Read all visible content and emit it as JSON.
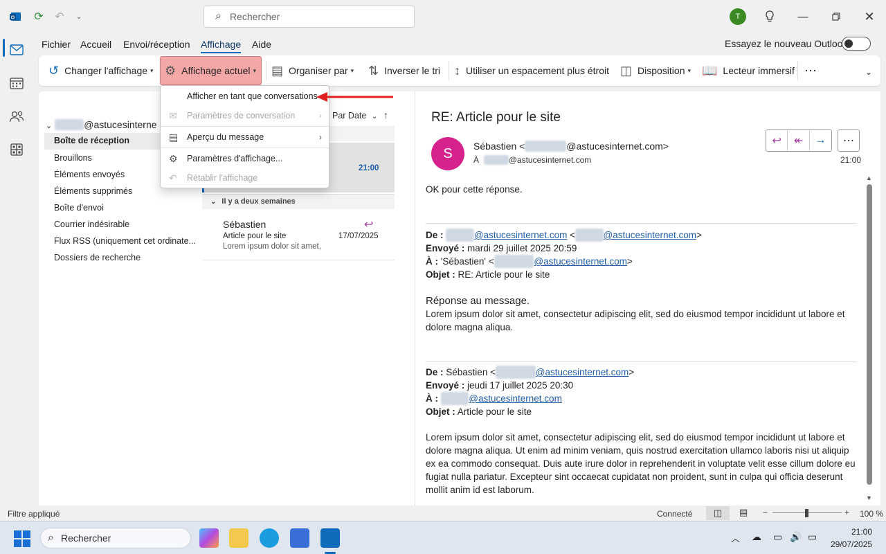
{
  "titlebar": {
    "search_placeholder": "Rechercher",
    "avatar_initial": "T"
  },
  "menu": {
    "tabs": [
      "Fichier",
      "Accueil",
      "Envoi/réception",
      "Affichage",
      "Aide"
    ],
    "active_tab": "Affichage",
    "new_outlook_label": "Essayez le nouveau Outlook"
  },
  "ribbon": {
    "change_view": "Changer l'affichage",
    "current_view": "Affichage actuel",
    "arrange_by": "Organiser par",
    "reverse_sort": "Inverser le tri",
    "compact_spacing": "Utiliser un espacement plus étroit",
    "layout": "Disposition",
    "immersive_reader": "Lecteur immersif"
  },
  "dropdown": {
    "items": [
      {
        "label": "Afficher en tant que conversations",
        "disabled": false
      },
      {
        "label": "Paramètres de conversation",
        "disabled": true
      },
      {
        "label": "Aperçu du message",
        "disabled": false
      },
      {
        "label": "Paramètres d'affichage...",
        "disabled": false
      },
      {
        "label": "Rétablir l'affichage",
        "disabled": true
      }
    ]
  },
  "folders": {
    "account_suffix": "@astucesinterne",
    "items": [
      "Boîte de réception",
      "Brouillons",
      "Éléments envoyés",
      "Éléments supprimés",
      "Boîte d'envoi",
      "Courrier indésirable",
      "Flux RSS (uniquement cet ordinate...",
      "Dossiers de recherche"
    ]
  },
  "message_list": {
    "sort_label": "Par Date",
    "selected_time": "21:00",
    "group_header": "Il y a deux semaines",
    "item": {
      "sender": "Sébastien",
      "subject": "Article pour le site",
      "preview": "Lorem ipsum dolor sit amet,",
      "date": "17/07/2025"
    }
  },
  "reading": {
    "subject": "RE: Article pour le site",
    "avatar_initial": "S",
    "from_name": "Sébastien <",
    "from_domain": "@astucesinternet.com>",
    "to_prefix": "À",
    "to_domain": "@astucesinternet.com",
    "time": "21:00",
    "body_first": "OK pour cette réponse.",
    "q1": {
      "de_label": "De :",
      "de_domain1": "@astucesinternet.com",
      "de_domain2": "@astucesinternet.com",
      "envoye_label": "Envoyé :",
      "envoye_value": "mardi 29 juillet 2025 20:59",
      "a_label": "À :",
      "a_value_prefix": "'Sébastien' <",
      "a_domain": "@astucesinternet.com",
      "objet_label": "Objet :",
      "objet_value": "RE: Article pour le site",
      "reply_title": "Réponse au message.",
      "reply_body": "Lorem ipsum dolor sit amet, consectetur adipiscing elit, sed do eiusmod tempor incididunt ut labore et dolore magna aliqua."
    },
    "q2": {
      "de_label": "De :",
      "de_value_prefix": "Sébastien <",
      "de_domain": "@astucesinternet.com",
      "envoye_label": "Envoyé :",
      "envoye_value": "jeudi 17 juillet 2025 20:30",
      "a_label": "À :",
      "a_domain": "@astucesinternet.com",
      "objet_label": "Objet :",
      "objet_value": "Article pour le site",
      "body": "Lorem ipsum dolor sit amet, consectetur adipiscing elit, sed do eiusmod tempor incididunt ut labore et dolore magna aliqua. Ut enim ad minim veniam, quis nostrud exercitation ullamco laboris nisi ut aliquip ex ea commodo consequat. Duis aute irure dolor in reprehenderit in voluptate velit esse cillum dolore eu fugiat nulla pariatur. Excepteur sint occaecat cupidatat non proident, sunt in culpa qui officia deserunt mollit anim id est laborum."
    }
  },
  "statusbar": {
    "filter": "Filtre appliqué",
    "connection": "Connecté",
    "zoom": "100 %"
  },
  "taskbar": {
    "search_placeholder": "Rechercher",
    "time": "21:00",
    "date": "29/07/2025"
  },
  "colors": {
    "accent": "#0f6cbd",
    "highlight": "#f4a7a7",
    "arrow": "#e02020",
    "avatar_s": "#d6228c"
  }
}
